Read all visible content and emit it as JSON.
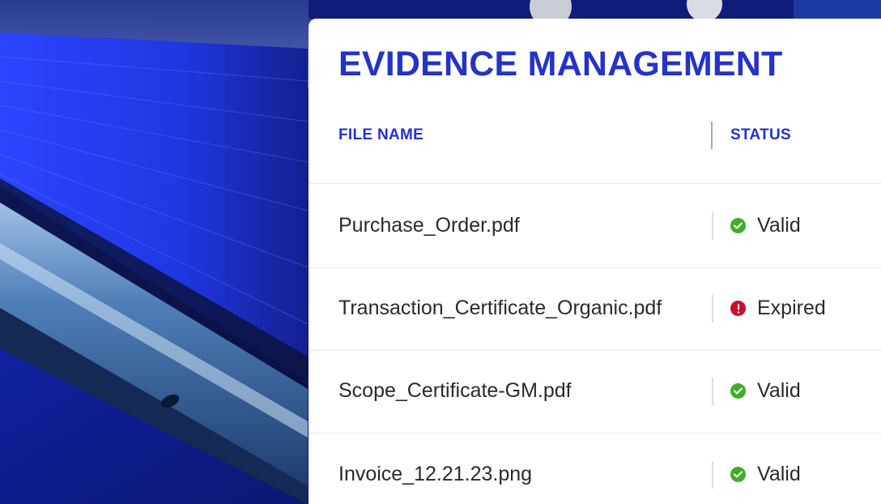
{
  "card": {
    "title": "EVIDENCE MANAGEMENT",
    "columns": {
      "file_name": "FILE NAME",
      "status": "STATUS"
    },
    "rows": [
      {
        "file": "Purchase_Order.pdf",
        "status": "Valid",
        "status_icon": "check-circle-icon"
      },
      {
        "file": "Transaction_Certificate_Organic.pdf",
        "status": "Expired",
        "status_icon": "exclamation-circle-icon"
      },
      {
        "file": "Scope_Certificate-GM.pdf",
        "status": "Valid",
        "status_icon": "check-circle-icon"
      },
      {
        "file": "Invoice_12.21.23.png",
        "status": "Valid",
        "status_icon": "check-circle-icon"
      }
    ]
  },
  "colors": {
    "accent": "#2433c8",
    "valid": "#3fae2a",
    "expired": "#c8102e",
    "text": "#2a2a2e"
  }
}
